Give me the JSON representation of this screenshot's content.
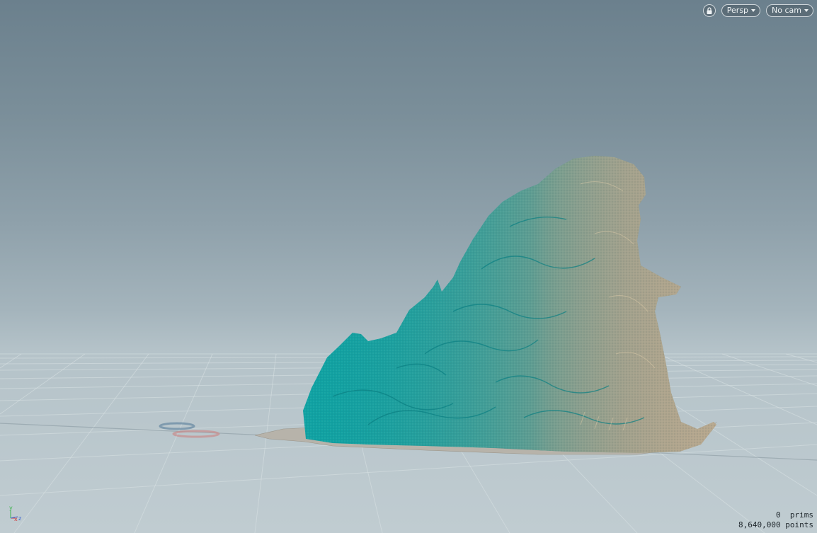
{
  "viewport": {
    "toolbar": {
      "lock_icon": "lock-icon",
      "view_menu_label": "Persp",
      "camera_menu_label": "No cam"
    },
    "stats": {
      "prims_value": "0",
      "prims_label": "prims",
      "points_value": "8,640,000",
      "points_label": "points"
    },
    "axis_gizmo": {
      "y_label": "y",
      "x_label": "x",
      "z_label": "z"
    },
    "colors": {
      "background_top": "#6b808d",
      "background_bottom": "#c0ccd1",
      "grid_line": "#9aa9b0",
      "points_primary": "#0d9a9c",
      "points_secondary": "#b9a88e",
      "axis_x": "#d23a3a",
      "axis_y": "#3fb34f",
      "axis_z": "#3a63d2"
    }
  }
}
